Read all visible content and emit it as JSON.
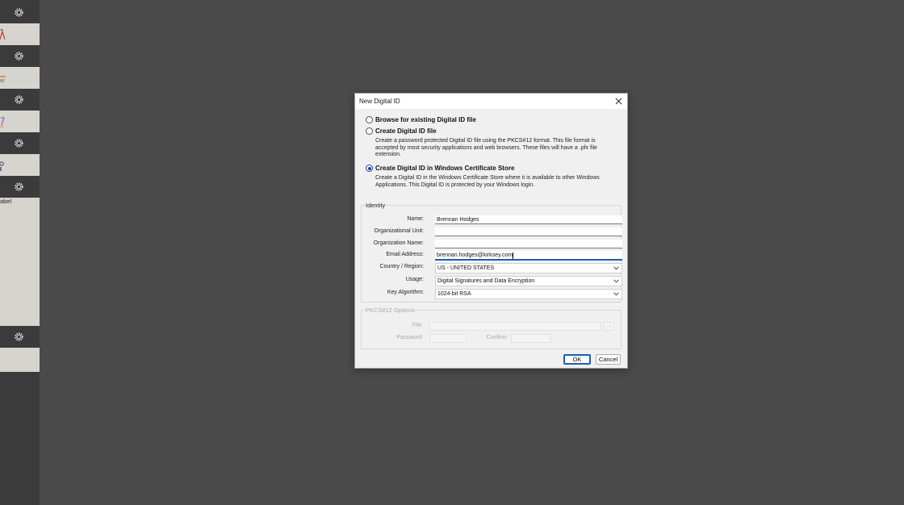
{
  "sidebar": {
    "partial_label": "abel"
  },
  "dialog": {
    "title": "New Digital ID",
    "options": [
      {
        "label": "Browse for existing Digital ID file",
        "selected": false
      },
      {
        "label": "Create Digital ID file",
        "selected": false,
        "description_lines": [
          "Create a password protected Digital ID file using the PKCS#12 format. This file format is",
          "accepted by most security applications and web browsers. These files will have a .pfx file",
          "extension."
        ]
      },
      {
        "label": "Create Digital ID in Windows Certificate Store",
        "selected": true,
        "description_lines": [
          "Create a Digital ID in the Windows Certificate Store where it is available to other Windows",
          "Applications. This Digital ID is protected by your Windows login."
        ]
      }
    ],
    "identity": {
      "group_title": "Identity",
      "name_label": "Name:",
      "name_value": "Brennan Hodges",
      "org_unit_label": "Organizational Unit:",
      "org_unit_value": "",
      "org_name_label": "Organization Name:",
      "org_name_value": "",
      "email_label": "Email Address:",
      "email_value": "brennan.hodges@kirksey.com",
      "country_label": "Country / Region:",
      "country_value": "US - UNITED STATES",
      "usage_label": "Usage:",
      "usage_value": "Digital Signatures and Data Encryption",
      "key_label": "Key Algorithm:",
      "key_value": "1024-bit RSA"
    },
    "pkcs": {
      "group_title": "PKCS#12 Options",
      "file_label": "File:",
      "browse_label": "...",
      "password_label": "Password:",
      "confirm_label": "Confirm:"
    },
    "buttons": {
      "ok": "OK",
      "cancel": "Cancel"
    }
  }
}
